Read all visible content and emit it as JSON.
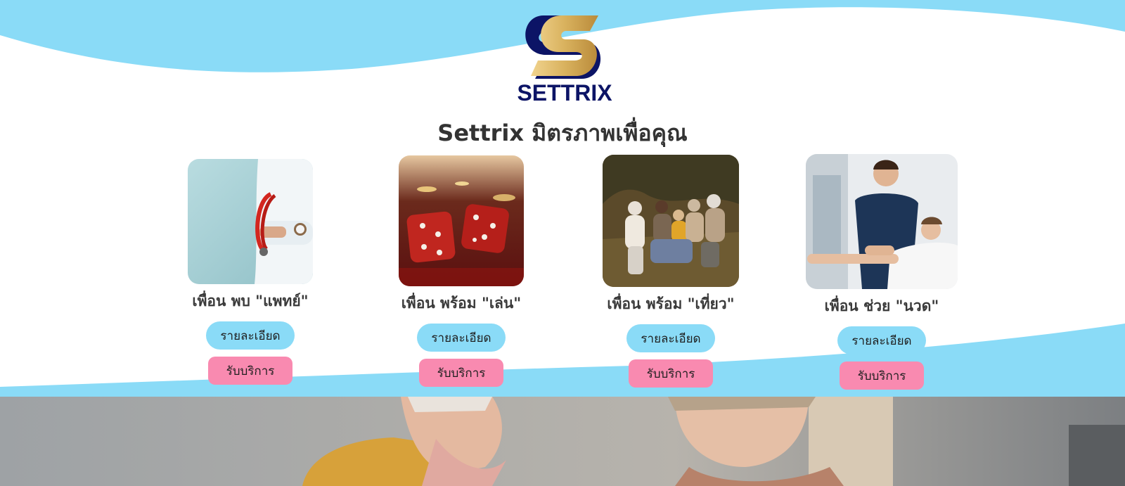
{
  "brand": {
    "name": "SETTRIX",
    "logo_icon": "settrix-s-logo",
    "colors": {
      "navy": "#0c1466",
      "gold": "#d9b25e"
    }
  },
  "page_title": "Settrix มิตรภาพเพื่อคุณ",
  "colors": {
    "accent_blue": "#8adbf7",
    "accent_pink": "#f98ab0",
    "wave_blue": "#8adbf7"
  },
  "services": [
    {
      "name": "เพื่อน พบ \"แพทย์\"",
      "photo": "doctor-stethoscope-photo",
      "detail_label": "รายละเอียด",
      "book_label": "รับบริการ"
    },
    {
      "name": "เพื่อน พร้อม \"เล่น\"",
      "photo": "casino-dice-photo",
      "detail_label": "รายละเอียด",
      "book_label": "รับบริการ"
    },
    {
      "name": "เพื่อน พร้อม \"เที่ยว\"",
      "photo": "elderly-group-outdoors-photo",
      "detail_label": "รายละเอียด",
      "book_label": "รับบริการ"
    },
    {
      "name": "เพื่อน ช่วย \"นวด\"",
      "photo": "physiotherapy-massage-photo",
      "detail_label": "รายละเอียด",
      "book_label": "รับบริการ"
    }
  ],
  "hero": {
    "photo": "caregiver-with-elderly-woman-photo"
  }
}
